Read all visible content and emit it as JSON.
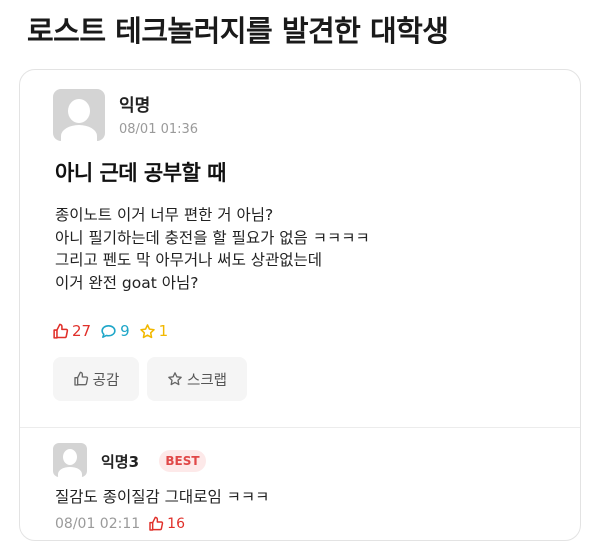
{
  "headline": "로스트 테크놀러지를 발견한 대학생",
  "post": {
    "author": "익명",
    "time": "08/01 01:36",
    "title": "아니 근데 공부할 때",
    "body": [
      "종이노트 이거 너무 편한 거 아님?",
      "아니 필기하는데 충전을 할 필요가 없음 ㅋㅋㅋㅋ",
      "그리고 펜도 막 아무거나 써도 상관없는데",
      "이거 완전 goat 아님?"
    ],
    "stats": {
      "likes": "27",
      "comments": "9",
      "scraps": "1"
    },
    "buttons": {
      "like": "공감",
      "scrap": "스크랩"
    }
  },
  "comment": {
    "author": "익명3",
    "badge": "BEST",
    "text": "질감도 종이질감 그대로임 ㅋㅋㅋ",
    "time": "08/01 02:11",
    "likes": "16"
  },
  "colors": {
    "like": "#e0302a",
    "comment": "#1ea6c8",
    "scrap": "#f2b800",
    "badge_bg": "#fde9e9",
    "badge_text": "#e04848"
  },
  "icons": [
    "avatar-placeholder-icon",
    "thumbs-up-icon",
    "speech-bubble-icon",
    "star-icon"
  ]
}
